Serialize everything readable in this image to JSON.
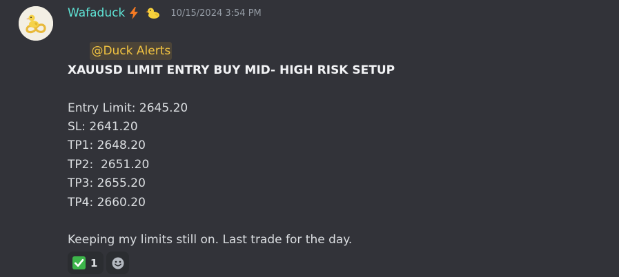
{
  "author": {
    "username": "Wafaduck",
    "badges": [
      "lightning-badge-icon",
      "duck-badge-icon"
    ],
    "timestamp": "10/15/2024 3:54 PM"
  },
  "message": {
    "mention": "@Duck Alerts",
    "heading": "XAUUSD LIMIT ENTRY BUY MID- HIGH RISK SETUP",
    "levels": [
      "Entry Limit: 2645.20",
      "SL: 2641.20",
      "TP1: 2648.20",
      "TP2:  2651.20",
      "TP3: 2655.20",
      "TP4: 2660.20"
    ],
    "footer": "Keeping my limits still on. Last trade for the day."
  },
  "reactions": [
    {
      "icon": "check-mark-icon",
      "count": "1"
    }
  ],
  "add_reaction_icon": "smiley-add-icon",
  "colors": {
    "background": "#323339",
    "username": "#5fe4d6",
    "mention_text": "#f0c241",
    "timestamp": "#949ba4",
    "check": "#3db54a"
  }
}
